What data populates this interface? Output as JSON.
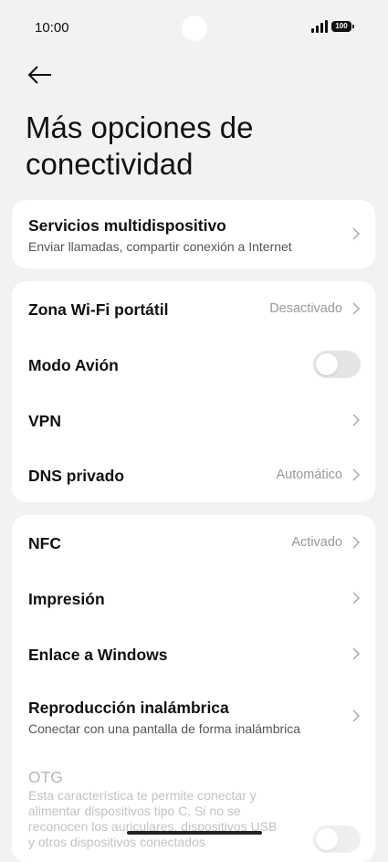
{
  "status_bar": {
    "time": "10:00",
    "battery": "100"
  },
  "header": {
    "title": "Más opciones de conectividad"
  },
  "group1": [
    {
      "title": "Servicios multidispositivo",
      "subtitle": "Enviar llamadas, compartir conexión a Internet"
    }
  ],
  "group2": [
    {
      "title": "Zona Wi-Fi portátil",
      "value": "Desactivado"
    },
    {
      "title": "Modo Avión",
      "toggle": false
    },
    {
      "title": "VPN"
    },
    {
      "title": "DNS privado",
      "value": "Automático"
    }
  ],
  "group3": [
    {
      "title": "NFC",
      "value": "Activado"
    },
    {
      "title": "Impresión"
    },
    {
      "title": "Enlace a Windows"
    },
    {
      "title": "Reproducción inalámbrica",
      "subtitle": "Conectar con una pantalla de forma inalámbrica"
    },
    {
      "title": "OTG",
      "subtitle": "Esta característica te permite conectar y alimentar dispositivos tipo C. Si no se reconocen los auriculares, dispositivos USB y otros dispositivos conectados",
      "toggle": false,
      "disabled": true
    }
  ]
}
